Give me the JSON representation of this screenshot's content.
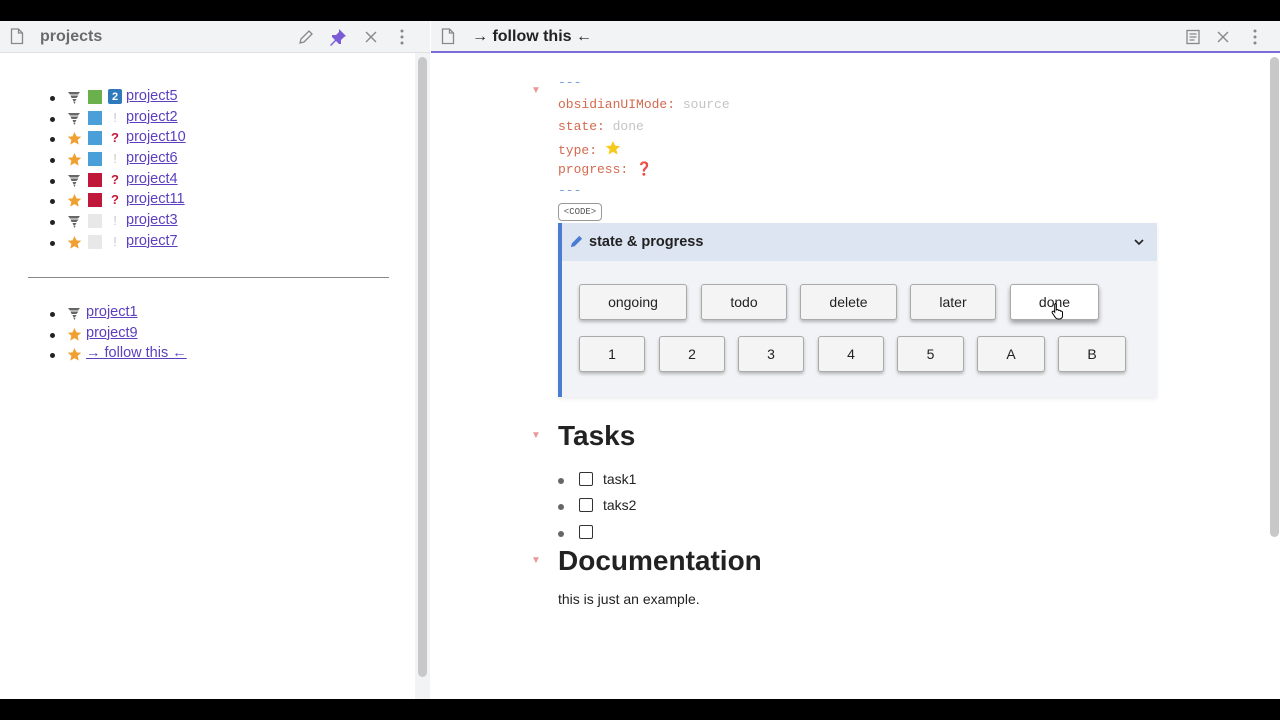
{
  "left": {
    "title": "projects",
    "list_a": [
      {
        "icon": "tornado",
        "square": "green",
        "badge": "2",
        "badge_type": "num",
        "label": "project5"
      },
      {
        "icon": "tornado",
        "square": "blue",
        "badge": "!",
        "badge_type": "excl",
        "label": "project2"
      },
      {
        "icon": "star",
        "square": "blue",
        "badge": "?",
        "badge_type": "q",
        "label": "project10"
      },
      {
        "icon": "star",
        "square": "blue",
        "badge": "!",
        "badge_type": "excl",
        "label": "project6"
      },
      {
        "icon": "tornado",
        "square": "red",
        "badge": "?",
        "badge_type": "q",
        "label": "project4"
      },
      {
        "icon": "star",
        "square": "red",
        "badge": "?",
        "badge_type": "q",
        "label": "project11"
      },
      {
        "icon": "tornado",
        "square": "gray",
        "badge": "!",
        "badge_type": "excl",
        "label": "project3"
      },
      {
        "icon": "star",
        "square": "gray",
        "badge": "!",
        "badge_type": "excl",
        "label": "project7"
      }
    ],
    "list_b": [
      {
        "icon": "tornado",
        "label": "project1"
      },
      {
        "icon": "star",
        "label": "project9"
      },
      {
        "icon": "star",
        "label": "→ follow this ←"
      }
    ]
  },
  "right": {
    "title": "→ follow this ←",
    "frontmatter": {
      "dash_open": "---",
      "dash_close": "---",
      "ui_mode_key": "obsidianUIMode:",
      "ui_mode_val": "source",
      "state_key": "state:",
      "state_val": "done",
      "type_key": "type:",
      "progress_key": "progress:",
      "progress_val": "❓"
    },
    "code_label": "<CODE>",
    "callout": {
      "title": "state & progress",
      "state_buttons": [
        "ongoing",
        "todo",
        "delete",
        "later",
        "done"
      ],
      "progress_buttons": [
        "1",
        "2",
        "3",
        "4",
        "5",
        "A",
        "B"
      ]
    },
    "tasks_heading": "Tasks",
    "tasks": [
      "task1",
      "taks2",
      ""
    ],
    "doc_heading": "Documentation",
    "doc_text": "this is just an example."
  },
  "colors": {
    "accent": "#7b6cd9",
    "link": "#5b3fbf",
    "callout_border": "#4a7cd2",
    "frontmatter_key": "#d46a4f",
    "star": "#f0a030"
  }
}
